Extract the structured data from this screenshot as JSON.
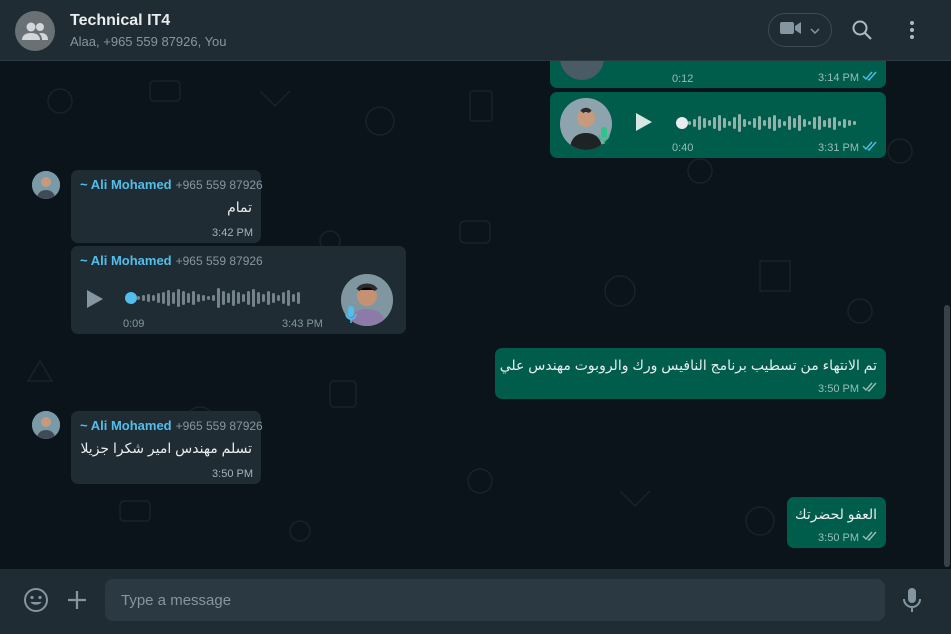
{
  "header": {
    "title": "Technical IT4",
    "subtitle": "Alaa, +965 559 87926, You"
  },
  "colors": {
    "accent": "#53bdeb",
    "outgoing_bubble": "#005c4b",
    "incoming_bubble": "#202c33",
    "read_ticks": "#53bdeb"
  },
  "icons": [
    "group-avatar-icon",
    "video-call-icon",
    "chevron-down-icon",
    "search-icon",
    "menu-icon",
    "play-icon",
    "mic-icon",
    "double-check-icon",
    "emoji-icon",
    "plus-icon"
  ],
  "messages": {
    "m1": {
      "duration": "0:12",
      "time": "3:14 PM"
    },
    "m2": {
      "duration": "0:40",
      "time": "3:31 PM"
    },
    "m3": {
      "sender": "~ Ali Mohamed",
      "phone": "+965 559 87926",
      "text": "تمام",
      "time": "3:42 PM"
    },
    "m4": {
      "sender": "~ Ali Mohamed",
      "phone": "+965 559 87926",
      "duration": "0:09",
      "time": "3:43 PM"
    },
    "m5": {
      "text": "تم الانتهاء من تسطيب برنامج النافيس ورك والروبوت مهندس علي",
      "time": "3:50 PM"
    },
    "m6": {
      "sender": "~ Ali Mohamed",
      "phone": "+965 559 87926",
      "text": "تسلم مهندس امير شكرا جزيلا",
      "time": "3:50 PM"
    },
    "m7": {
      "text": "العفو لحضرتك",
      "time": "3:50 PM"
    }
  },
  "composer": {
    "placeholder": "Type a message"
  }
}
